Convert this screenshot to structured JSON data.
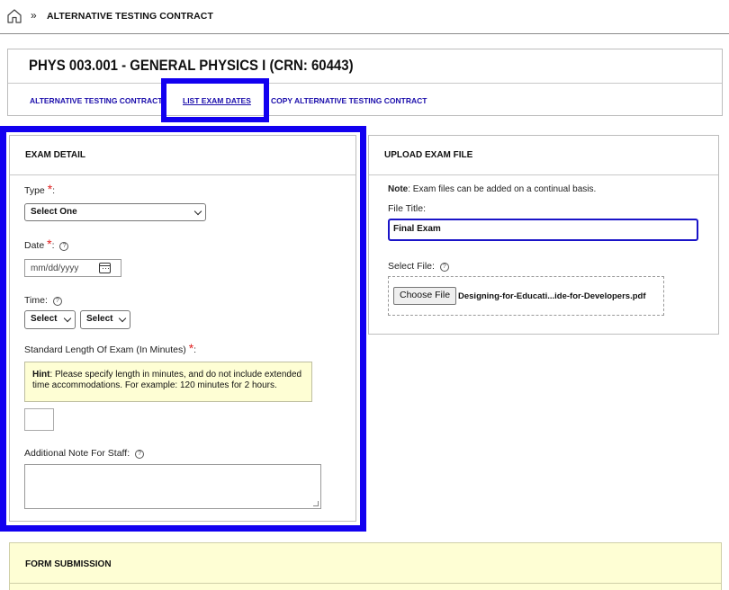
{
  "breadcrumb": {
    "separator": "»",
    "title": "ALTERNATIVE TESTING CONTRACT"
  },
  "course": {
    "title": "PHYS 003.001 - GENERAL PHYSICS I (CRN: 60443)",
    "tabs": [
      {
        "label": "ALTERNATIVE TESTING CONTRACT"
      },
      {
        "label": "LIST EXAM DATES"
      },
      {
        "label": "COPY ALTERNATIVE TESTING CONTRACT"
      }
    ]
  },
  "exam_detail": {
    "heading": "EXAM DETAIL",
    "type_label": "Type",
    "type_value": "Select One",
    "date_label": "Date",
    "date_placeholder": "mm/dd/yyyy",
    "time_label": "Time:",
    "hour_value": "Select",
    "minute_value": "Select",
    "length_label": "Standard Length Of Exam (In Minutes)",
    "hint_label": "Hint",
    "hint_text": ": Please specify length in minutes, and do not include extended time accommodations. For example: 120 minutes for 2 hours.",
    "note_label": "Additional Note For Staff:"
  },
  "upload": {
    "heading": "UPLOAD EXAM FILE",
    "note_label": "Note",
    "note_text": ": Exam files can be added on a continual basis.",
    "file_title_label": "File Title:",
    "file_title_value": "Final Exam",
    "select_file_label": "Select File:",
    "choose_button": "Choose File",
    "file_name": "Designing-for-Educati...ide-for-Developers.pdf"
  },
  "form_submission": {
    "heading": "FORM SUBMISSION"
  },
  "colors": {
    "highlight": "#1200f0",
    "link": "#1a0dab",
    "required": "#e02020",
    "hint_background": "#fefed4"
  }
}
